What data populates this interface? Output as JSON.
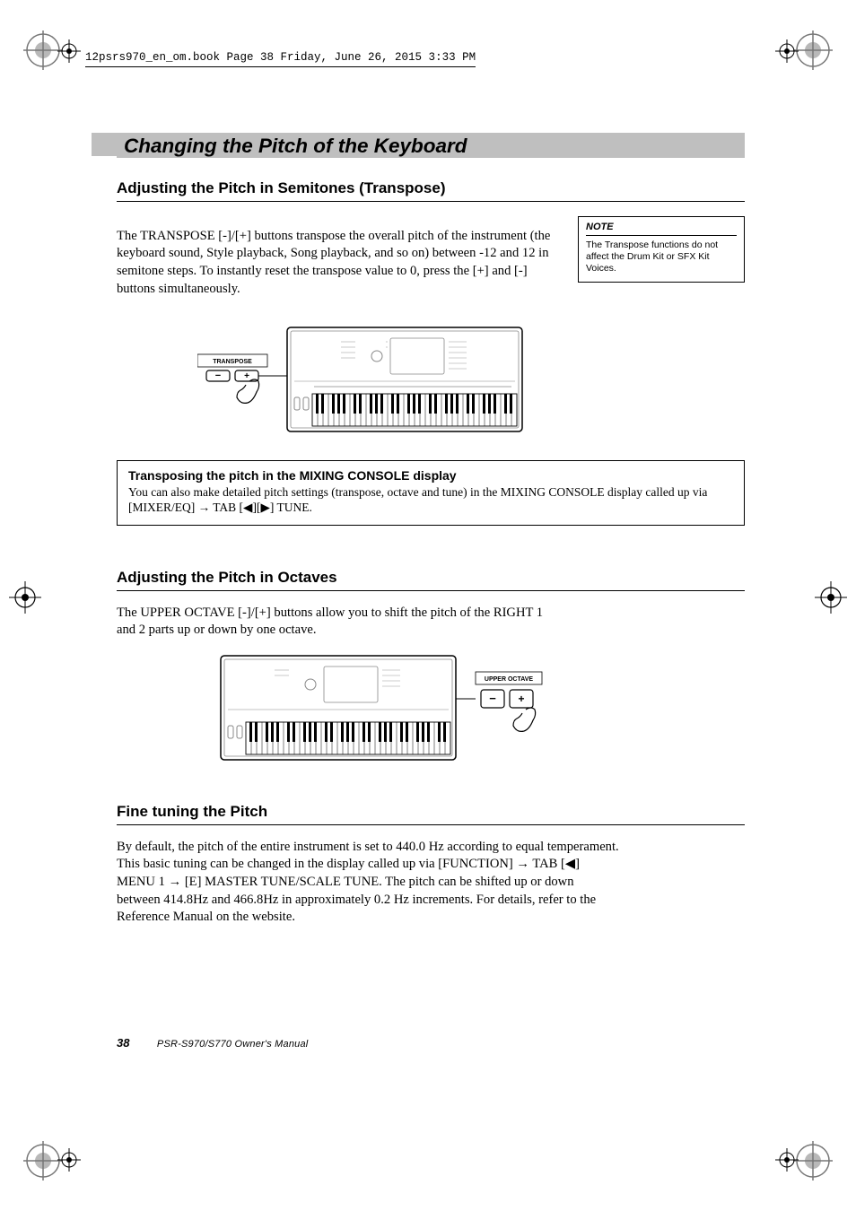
{
  "meta": {
    "header_line": "12psrs970_en_om.book  Page 38  Friday, June 26, 2015  3:33 PM"
  },
  "section": {
    "banner": "Changing the Pitch of the Keyboard"
  },
  "transpose": {
    "heading": "Adjusting the Pitch in Semitones (Transpose)",
    "body": "The TRANSPOSE [-]/[+] buttons transpose the overall pitch of the instrument (the keyboard sound, Style playback, Song playback, and so on) between -12 and 12 in semitone steps. To instantly reset the transpose value to 0, press the [+] and [-] buttons simultaneously.",
    "note_title": "NOTE",
    "note_text": "The Transpose functions do not affect the Drum Kit or SFX Kit Voices.",
    "diagram_label": "TRANSPOSE",
    "minus": "−",
    "plus": "+"
  },
  "callout": {
    "title": "Transposing the pitch in the MIXING CONSOLE display",
    "text_a": "You can also make detailed pitch settings (transpose, octave and tune) in the MIXING CONSOLE display called up via [MIXER/EQ] ",
    "text_b": " TAB [",
    "text_c": "][",
    "text_d": "] TUNE."
  },
  "octaves": {
    "heading": "Adjusting the Pitch in Octaves",
    "body": "The UPPER OCTAVE [-]/[+] buttons allow you to shift the pitch of the RIGHT 1 and 2 parts up or down by one octave.",
    "diagram_label": "UPPER OCTAVE",
    "minus": "−",
    "plus": "+"
  },
  "finetune": {
    "heading": "Fine tuning the Pitch",
    "body_a": "By default, the pitch of the entire instrument is set to 440.0 Hz according to equal temperament. This basic tuning can be changed in the display called up via [FUNCTION] ",
    "body_b": " TAB [",
    "body_c": "] MENU 1 ",
    "body_d": " [E] MASTER TUNE/SCALE TUNE. The pitch can be shifted up or down between 414.8Hz and 466.8Hz in approximately 0.2 Hz increments. For details, refer to the Reference Manual on the website."
  },
  "footer": {
    "page_num": "38",
    "doc_title": "PSR-S970/S770 Owner's Manual"
  }
}
